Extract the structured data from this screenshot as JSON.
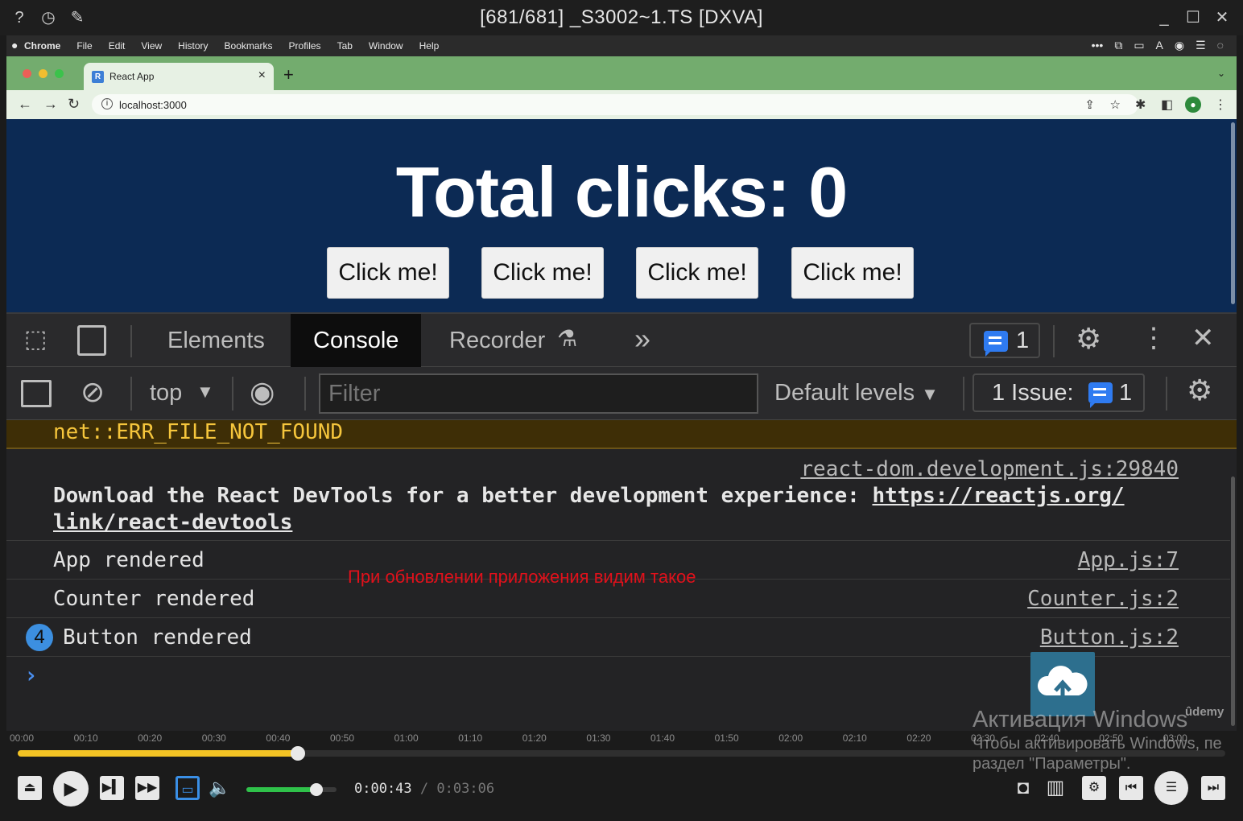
{
  "player": {
    "title": "[681/681] _S3002~1.TS [DXVA]",
    "icons": [
      "help-icon",
      "history-icon",
      "pin-icon",
      "minimize-icon",
      "maximize-icon",
      "close-icon"
    ]
  },
  "mac_menu": {
    "items": [
      "Chrome",
      "File",
      "Edit",
      "View",
      "History",
      "Bookmarks",
      "Profiles",
      "Tab",
      "Window",
      "Help"
    ]
  },
  "browser": {
    "tab_title": "React App",
    "favicon_letter": "R",
    "new_tab": "+",
    "tab_close": "×",
    "url": "localhost:3000",
    "colors": {
      "tabstrip": "#73ac6e",
      "toolbar": "#e7f1e4"
    }
  },
  "page": {
    "heading": "Total clicks: 0",
    "buttons": [
      "Click me!",
      "Click me!",
      "Click me!",
      "Click me!"
    ],
    "background": "#0c2a54"
  },
  "devtools": {
    "tabs": [
      "Elements",
      "Console",
      "Recorder"
    ],
    "active_tab": "Console",
    "more_tabs": "»",
    "issues_badge": "1",
    "context": "top",
    "filter_placeholder": "Filter",
    "levels": "Default levels",
    "issue_label": "1 Issue:",
    "issue_count": "1"
  },
  "console": {
    "error": "net::ERR_FILE_NOT_FOUND",
    "devtools_source": "react-dom.development.js:29840",
    "devtools_msg": "Download the React DevTools for a better development experience: ",
    "devtools_link_1": "https://reactjs.org/",
    "devtools_link_2": "link/react-devtools",
    "rows": [
      {
        "msg": "App rendered",
        "src": "App.js:7"
      },
      {
        "msg": "Counter rendered",
        "src": "Counter.js:2"
      },
      {
        "msg": "Button rendered",
        "src": "Button.js:2",
        "repeat": "4"
      }
    ],
    "prompt": "›"
  },
  "annotation": "При обновлении приложения видим такое",
  "timeline": {
    "labels": [
      "00:00",
      "00:10",
      "00:20",
      "00:30",
      "00:40",
      "00:50",
      "01:00",
      "01:10",
      "01:20",
      "01:30",
      "01:40",
      "01:50",
      "02:00",
      "02:10",
      "02:20",
      "02:30",
      "02:40",
      "02:50",
      "03:00"
    ],
    "progress": 0.232,
    "volume": 0.78,
    "current": "0:00:43",
    "separator": "/",
    "duration": "0:03:06",
    "accent": "#f3c324"
  },
  "watermark": {
    "line1": "Активация Windows",
    "line2": "Чтобы активировать Windows, пе",
    "line3": "раздел \"Параметры\".",
    "brand": "ûdemy"
  }
}
